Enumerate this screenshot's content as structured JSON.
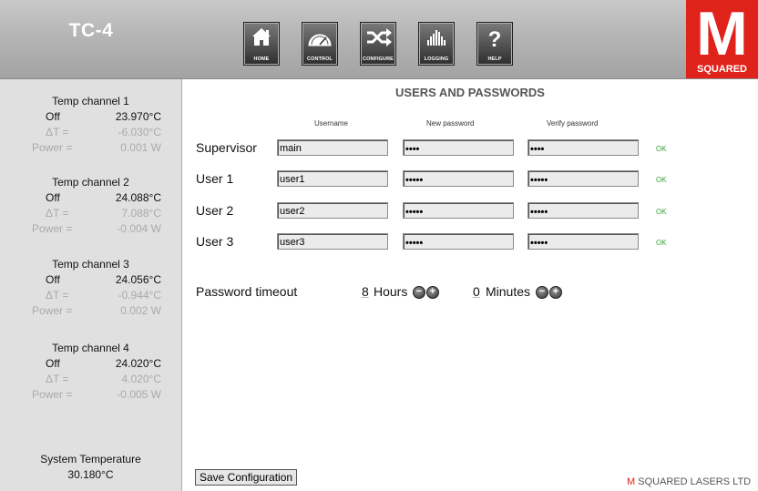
{
  "header": {
    "app_title": "TC-4",
    "nav": [
      {
        "label": "HOME",
        "icon": "home-icon"
      },
      {
        "label": "CONTROL",
        "icon": "gauge-icon"
      },
      {
        "label": "CONFIGURE",
        "icon": "shuffle-icon"
      },
      {
        "label": "LOGGING",
        "icon": "bars-icon"
      },
      {
        "label": "HELP",
        "icon": "question-icon"
      }
    ],
    "logo": {
      "big": "M",
      "small": "SQUARED",
      "color": "#e0231a"
    }
  },
  "sidebar": {
    "channels": [
      {
        "title": "Temp channel 1",
        "state": "Off",
        "temp": "23.970°C",
        "dt_label": "ΔT =",
        "dt": "-6.030°C",
        "power_label": "Power =",
        "power": "0.001 W"
      },
      {
        "title": "Temp channel 2",
        "state": "Off",
        "temp": "24.088°C",
        "dt_label": "ΔT =",
        "dt": "7.088°C",
        "power_label": "Power =",
        "power": "-0.004 W"
      },
      {
        "title": "Temp channel 3",
        "state": "Off",
        "temp": "24.056°C",
        "dt_label": "ΔT =",
        "dt": "-0.944°C",
        "power_label": "Power =",
        "power": "0.002 W"
      },
      {
        "title": "Temp channel 4",
        "state": "Off",
        "temp": "24.020°C",
        "dt_label": "ΔT =",
        "dt": "4.020°C",
        "power_label": "Power =",
        "power": "-0.005 W"
      }
    ],
    "system": {
      "title": "System Temperature",
      "value": "30.180°C"
    }
  },
  "main": {
    "title": "USERS AND PASSWORDS",
    "col_username": "Username",
    "col_new_password": "New password",
    "col_verify_password": "Verify password",
    "users": [
      {
        "label": "Supervisor",
        "username": "main",
        "new_password": "••••",
        "verify_password": "••••",
        "status": "OK"
      },
      {
        "label": "User 1",
        "username": "user1",
        "new_password": "•••••",
        "verify_password": "•••••",
        "status": "OK"
      },
      {
        "label": "User 2",
        "username": "user2",
        "new_password": "•••••",
        "verify_password": "•••••",
        "status": "OK"
      },
      {
        "label": "User 3",
        "username": "user3",
        "new_password": "•••••",
        "verify_password": "•••••",
        "status": "OK"
      }
    ],
    "timeout": {
      "label": "Password timeout",
      "hours_value": "8",
      "hours_unit": "Hours",
      "minutes_value": "0",
      "minutes_unit": "Minutes",
      "minus": "−",
      "plus": "+"
    },
    "save_label": "Save Configuration",
    "footer_brand": "M",
    "footer_text": " SQUARED LASERS LTD"
  }
}
